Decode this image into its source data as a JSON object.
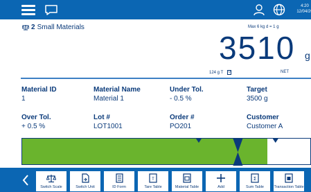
{
  "status_bar": {
    "time": "4:20",
    "date": "12/04/20"
  },
  "scale": {
    "number": "2",
    "name": "Small Materials",
    "max_info": "Max 6 kg d = 1 g",
    "weight": "3510",
    "unit": "g",
    "tare": "124 g T",
    "zero_symbol": "0",
    "net_label": "NET"
  },
  "fields": [
    {
      "label": "Material ID",
      "value": "1"
    },
    {
      "label": "Material Name",
      "value": "Material 1"
    },
    {
      "label": "Under Tol.",
      "value": "- 0.5 %"
    },
    {
      "label": "Target",
      "value": "3500 g"
    },
    {
      "label": "Over Tol.",
      "value": "+ 0.5 %"
    },
    {
      "label": "Lot #",
      "value": "LOT1001"
    },
    {
      "label": "Order #",
      "value": "PO201"
    },
    {
      "label": "Customer",
      "value": "Customer A"
    }
  ],
  "tolerance_bar": {
    "fill_fraction": 0.85,
    "fill_color": "#6ab42d",
    "lower_marker_fraction": 0.61,
    "target_marker_fraction": 0.745,
    "upper_marker_fraction": 0.875
  },
  "softkeys": [
    {
      "label": "Switch Scale",
      "icon": "switch-scale-icon"
    },
    {
      "label": "Switch Unit",
      "icon": "switch-unit-icon"
    },
    {
      "label": "ID Form",
      "icon": "id-form-icon"
    },
    {
      "label": "Tare Table",
      "icon": "tare-table-icon"
    },
    {
      "label": "Material Table",
      "icon": "material-table-icon"
    },
    {
      "label": "Add",
      "icon": "add-icon"
    },
    {
      "label": "Sum Table",
      "icon": "sum-table-icon"
    },
    {
      "label": "Transaction Table",
      "icon": "transaction-table-icon"
    }
  ],
  "colors": {
    "bar_blue": "#0b66b3",
    "text_navy": "#0a3a7a",
    "tolerance_green": "#6ab42d"
  }
}
